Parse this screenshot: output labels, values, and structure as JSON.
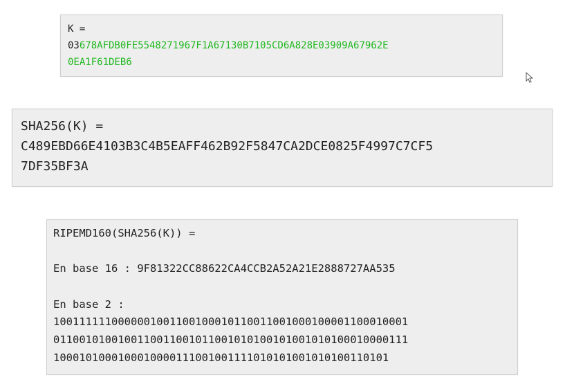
{
  "key_block": {
    "label": "K =",
    "prefix": "03",
    "hex_line1": "678AFDB0FE5548271967F1A67130B7105CD6A828E03909A67962E",
    "hex_line2": "0EA1F61DEB6"
  },
  "sha_block": {
    "label": "SHA256(K) =",
    "line1": "C489EBD66E4103B3C4B5EAFF462B92F5847CA2DCE0825F4997C7CF5",
    "line2": "7DF35BF3A"
  },
  "ripemd_block": {
    "label": "RIPEMD160(SHA256(K)) =",
    "base16_line": "En base 16 : 9F81322CC88622CA4CCB2A52A21E2888727AA535",
    "base2_label": "En base 2 :",
    "base2_lines": [
      "1001111110000001001100100010110011001000100001100010001",
      "0110010100100110011001011001010100101001010100010000111",
      "1000101000100010000111001001111010101001010100110101"
    ]
  },
  "colors": {
    "highlight_green": "#1fb81f",
    "box_background": "#eeeeee"
  },
  "icons": {
    "pointer": "mouse-cursor-icon"
  }
}
